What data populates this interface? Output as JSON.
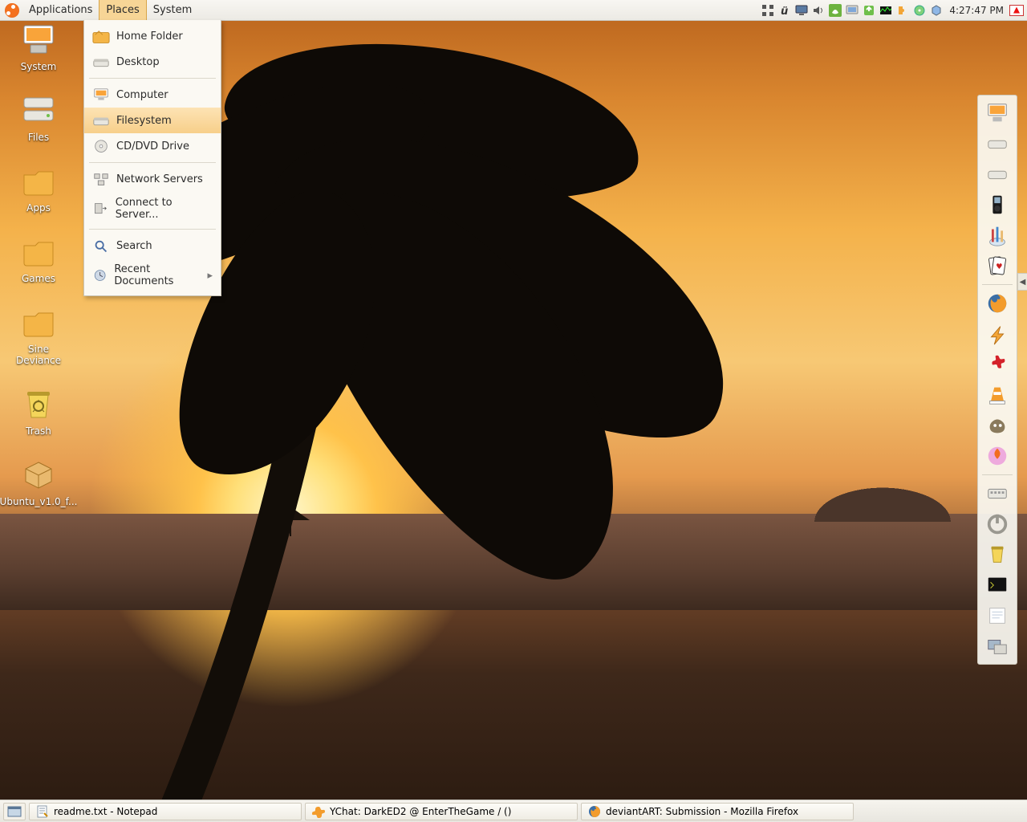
{
  "top_panel": {
    "menus": {
      "applications": "Applications",
      "places": "Places",
      "system": "System"
    },
    "clock": "4:27:47 PM",
    "tray_icons": [
      "menu-grid-icon",
      "keyboard-u-icon",
      "display-icon",
      "volume-icon",
      "nvidia-icon",
      "wifi-icon",
      "update-manager-icon",
      "network-monitor-icon",
      "jigsaw-icon",
      "disc-icon",
      "cube-icon"
    ]
  },
  "places_menu": {
    "items": [
      {
        "label": "Home Folder",
        "icon": "home-folder-icon"
      },
      {
        "label": "Desktop",
        "icon": "drive-icon"
      }
    ],
    "items2": [
      {
        "label": "Computer",
        "icon": "computer-icon"
      },
      {
        "label": "Filesystem",
        "icon": "drive-icon",
        "hover": true
      },
      {
        "label": "CD/DVD Drive",
        "icon": "optical-drive-icon"
      }
    ],
    "items3": [
      {
        "label": "Network Servers",
        "icon": "network-servers-icon"
      },
      {
        "label": "Connect to Server...",
        "icon": "connect-server-icon"
      }
    ],
    "items4": [
      {
        "label": "Search",
        "icon": "search-icon"
      },
      {
        "label": "Recent Documents",
        "icon": "recent-documents-icon"
      }
    ]
  },
  "desktop_icons": [
    {
      "label": "System",
      "icon": "computer-icon"
    },
    {
      "label": "Files",
      "icon": "drive-stack-icon"
    },
    {
      "label": "Apps",
      "icon": "folder-icon"
    },
    {
      "label": "Games",
      "icon": "folder-icon"
    },
    {
      "label": "Sine Deviance",
      "icon": "folder-icon"
    },
    {
      "label": "Trash",
      "icon": "trash-icon"
    },
    {
      "label": "Ubuntu_v1.0_f...",
      "icon": "package-icon"
    }
  ],
  "dock_icons": [
    "computer-icon",
    "drive-icon",
    "drive-icon",
    "ipod-icon",
    "brushes-icon",
    "cards-icon",
    "sep",
    "firefox-icon",
    "winamp-icon",
    "splat-icon",
    "vlc-icon",
    "gimp-icon",
    "burn-icon",
    "sep",
    "keyboard-layout-icon",
    "power-icon",
    "trash-icon",
    "terminal-icon",
    "notes-icon",
    "window-switch-icon"
  ],
  "taskbar": [
    {
      "icon": "notepad-icon",
      "label": "readme.txt - Notepad"
    },
    {
      "icon": "ychat-icon",
      "label": "YChat: DarkED2 @ EnterTheGame /  ()"
    },
    {
      "icon": "firefox-icon",
      "label": "deviantART: Submission - Mozilla Firefox"
    }
  ]
}
